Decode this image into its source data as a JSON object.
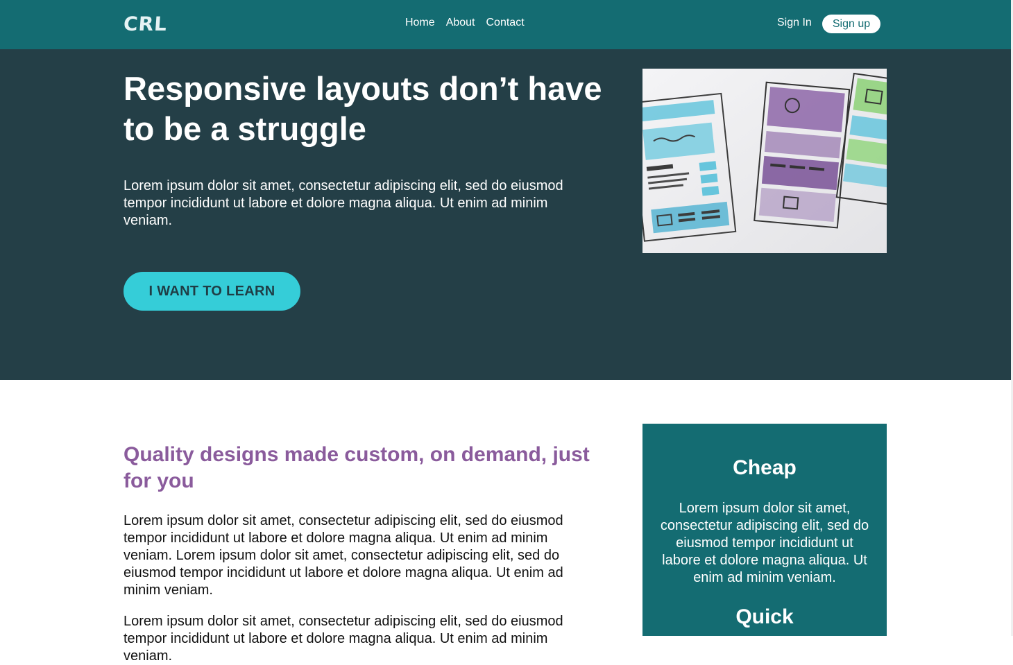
{
  "nav": {
    "logo": "CRL",
    "links": [
      "Home",
      "About",
      "Contact"
    ],
    "sign_in": "Sign In",
    "sign_up": "Sign up"
  },
  "hero": {
    "title": "Responsive layouts don’t have to be a struggle",
    "text": "Lorem ipsum dolor sit amet, consectetur adipiscing elit, sed do eiusmod tempor incididunt ut labore et dolore magna aliqua. Ut enim ad minim veniam.",
    "cta": "I WANT TO LEARN"
  },
  "main": {
    "heading": "Quality designs made custom, on demand, just for you",
    "paragraphs": [
      "Lorem ipsum dolor sit amet, consectetur adipiscing elit, sed do eiusmod tempor incididunt ut labore et dolore magna aliqua. Ut enim ad minim veniam. Lorem ipsum dolor sit amet, consectetur adipiscing elit, sed do eiusmod tempor incididunt ut labore et dolore magna aliqua. Ut enim ad minim veniam.",
      "Lorem ipsum dolor sit amet, consectetur adipiscing elit, sed do eiusmod tempor incididunt ut labore et dolore magna aliqua. Ut enim ad minim veniam."
    ]
  },
  "features": [
    {
      "title": "Cheap",
      "text": "Lorem ipsum dolor sit amet, consectetur adipiscing elit, sed do eiusmod tempor incididunt ut labore et dolore magna aliqua. Ut enim ad minim veniam."
    },
    {
      "title": "Quick"
    }
  ],
  "colors": {
    "nav_bg": "#146c72",
    "hero_bg": "#243f47",
    "cta_bg": "#35cdd8",
    "heading_accent": "#8a5b9c",
    "feature_bg": "#146c72"
  }
}
